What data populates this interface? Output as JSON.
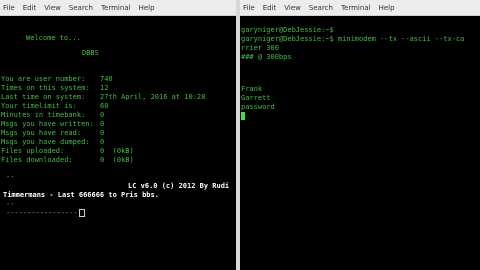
{
  "left": {
    "menu": [
      "File",
      "Edit",
      "View",
      "Search",
      "Terminal",
      "Help"
    ],
    "welcome": "Welcome to...",
    "bbs_name": "DBBS",
    "stats": [
      {
        "label": "You are user number:",
        "value": "740"
      },
      {
        "label": "Times on this system:",
        "value": "12"
      },
      {
        "label": "Last time on system:",
        "value": "27th April, 2016 at 10:28"
      },
      {
        "label": "Your timelimit is:",
        "value": "60"
      },
      {
        "label": "Minutes in timebank:",
        "value": "0"
      },
      {
        "label": "Msgs you have written:",
        "value": "0"
      },
      {
        "label": "Msgs you have read:",
        "value": "0"
      },
      {
        "label": "Msgs you have dumped:",
        "value": "0"
      },
      {
        "label": "Files uploaded:",
        "value": "0  (0kB)"
      },
      {
        "label": "Files downloaded:",
        "value": "0  (0kB)"
      }
    ],
    "dash_top": "--",
    "credit_line1": "LC v6.0 (c) 2012 By Rudi",
    "credit_line2": "Timmermans - Last 666666 to Pris bbs.",
    "dash_mid": "--",
    "dash_bottom": "-----------------"
  },
  "right": {
    "menu": [
      "File",
      "Edit",
      "View",
      "Search",
      "Terminal",
      "Help"
    ],
    "lines": [
      "garyniger@DebJessie:~$",
      "garyniger@DebJessie:~$ minimodem --tx --ascii --tx-ca",
      "rrier 300",
      "### @ 300bps",
      "",
      "",
      "",
      "Frank",
      "Garrett",
      "password"
    ]
  }
}
